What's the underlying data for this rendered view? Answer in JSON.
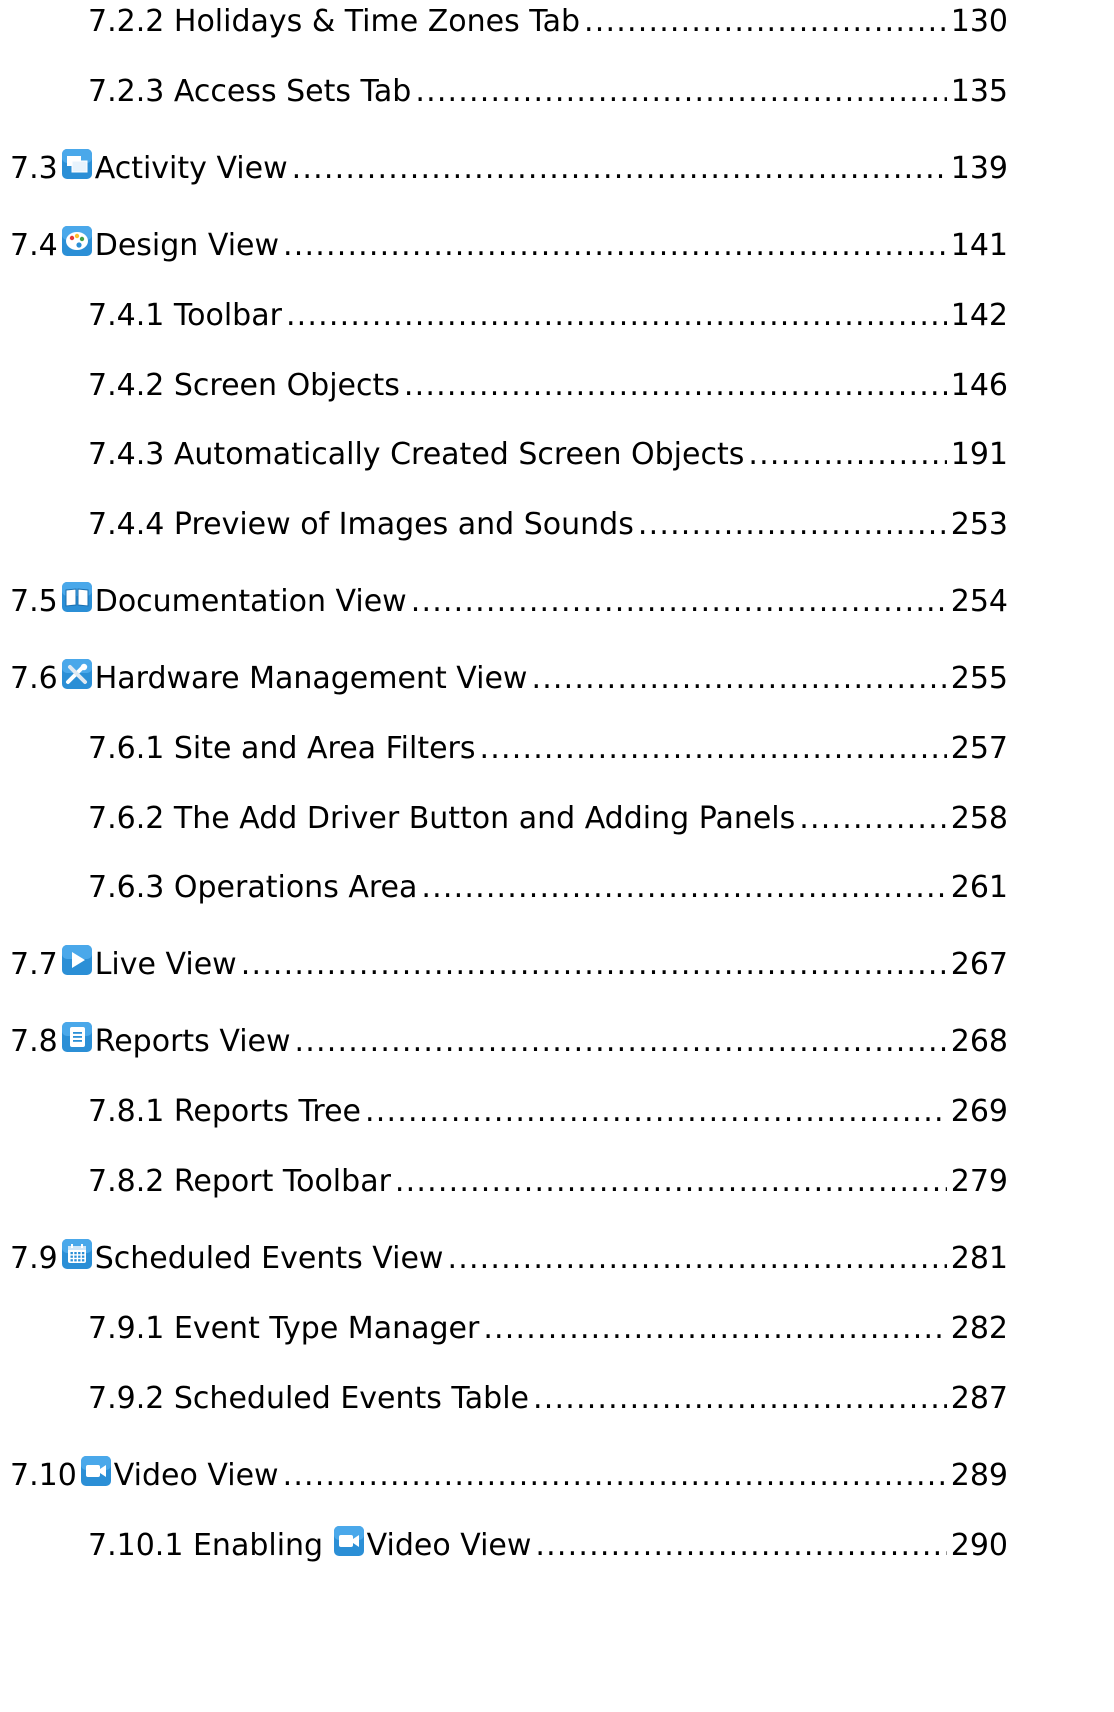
{
  "toc": {
    "entries": [
      {
        "level": 2,
        "number": "7.2.2",
        "title": "Holidays & Time Zones Tab",
        "page": "130"
      },
      {
        "level": 2,
        "number": "7.2.3",
        "title": "Access Sets Tab",
        "page": "135"
      },
      {
        "level": 1,
        "number": "7.3",
        "icon": "activity-view-icon",
        "title": "Activity View",
        "page": "139"
      },
      {
        "level": 1,
        "number": "7.4",
        "icon": "design-view-palette-icon",
        "title": "Design View",
        "page": "141"
      },
      {
        "level": 2,
        "number": "7.4.1",
        "title": "Toolbar",
        "page": "142"
      },
      {
        "level": 2,
        "number": "7.4.2",
        "title": "Screen Objects",
        "page": "146"
      },
      {
        "level": 2,
        "number": "7.4.3",
        "title": "Automatically Created Screen Objects",
        "page": "191"
      },
      {
        "level": 2,
        "number": "7.4.4",
        "title": "Preview of Images and Sounds",
        "page": "253"
      },
      {
        "level": 1,
        "number": "7.5",
        "icon": "documentation-book-icon",
        "title": "Documentation View",
        "page": "254"
      },
      {
        "level": 1,
        "number": "7.6",
        "icon": "hardware-tools-icon",
        "title": "Hardware Management View",
        "page": "255"
      },
      {
        "level": 2,
        "number": "7.6.1",
        "title": "Site and Area Filters",
        "page": "257"
      },
      {
        "level": 2,
        "number": "7.6.2",
        "title": "The Add Driver Button and Adding Panels",
        "page": "258"
      },
      {
        "level": 2,
        "number": "7.6.3",
        "title": "Operations Area",
        "page": "261"
      },
      {
        "level": 1,
        "number": "7.7",
        "icon": "live-view-play-icon",
        "title": "Live View",
        "page": "267"
      },
      {
        "level": 1,
        "number": "7.8",
        "icon": "reports-document-icon",
        "title": "Reports View",
        "page": "268"
      },
      {
        "level": 2,
        "number": "7.8.1",
        "title": "Reports Tree",
        "page": "269"
      },
      {
        "level": 2,
        "number": "7.8.2",
        "title": "Report Toolbar",
        "page": "279"
      },
      {
        "level": 1,
        "number": "7.9",
        "icon": "calendar-icon",
        "title": "Scheduled Events View",
        "page": "281"
      },
      {
        "level": 2,
        "number": "7.9.1",
        "title": "Event Type Manager",
        "page": "282"
      },
      {
        "level": 2,
        "number": "7.9.2",
        "title": "Scheduled Events Table",
        "page": "287"
      },
      {
        "level": 1,
        "number": "7.10",
        "icon": "video-camera-icon",
        "title": "Video View",
        "page": "289"
      },
      {
        "level": 2,
        "number": "7.10.1",
        "title_prefix": "Enabling",
        "icon": "video-camera-icon",
        "title": "Video View",
        "page": "290"
      }
    ]
  },
  "colors": {
    "text": "#000000",
    "icon_blue": "#2b8fd6",
    "icon_blue_dark": "#1a6fb0"
  }
}
